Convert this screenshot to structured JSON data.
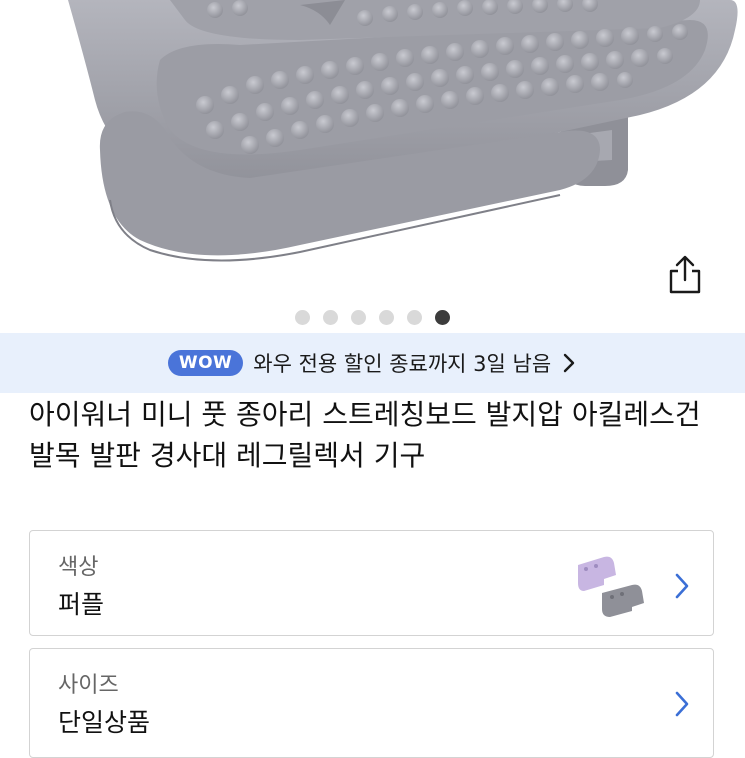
{
  "gallery": {
    "dot_count": 6,
    "active_index": 5
  },
  "promo": {
    "badge": "WOW",
    "text": "와우 전용 할인 종료까지 3일 남음"
  },
  "product": {
    "title": "아이워너 미니 풋 종아리 스트레칭보드 발지압 아킬레스건 발목 발판 경사대 레그릴렉서 기구"
  },
  "options": {
    "color": {
      "label": "색상",
      "value": "퍼플"
    },
    "size": {
      "label": "사이즈",
      "value": "단일상품"
    }
  },
  "colors": {
    "accent": "#4a74d9",
    "promo_bg": "#e8f0fc",
    "product_gray": "#a7a8b0",
    "product_purple": "#c8b6e2"
  }
}
